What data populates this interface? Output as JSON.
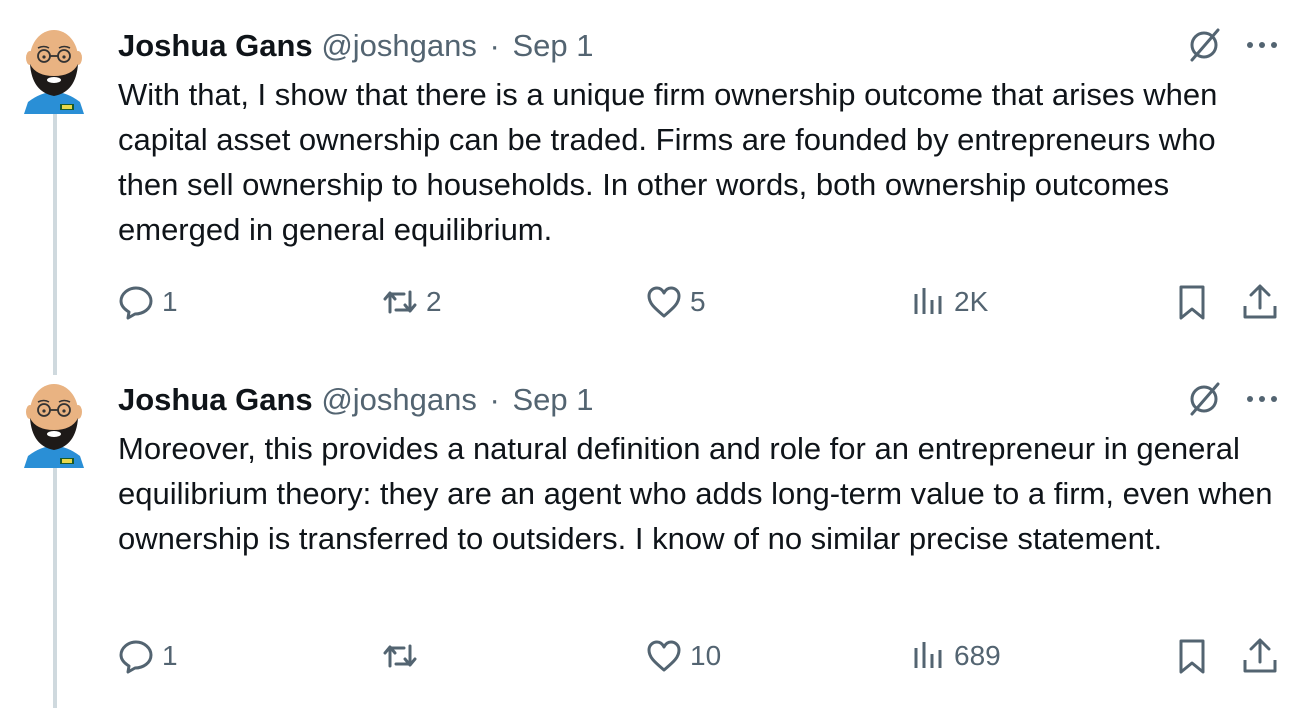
{
  "tweets": [
    {
      "author_name": "Joshua Gans",
      "handle": "@joshgans",
      "separator": "·",
      "date": "Sep 1",
      "text": "With that, I show that there is a unique firm ownership outcome that arises when capital asset ownership can be traded. Firms are founded by entrepreneurs who then sell ownership to households. In other words, both ownership outcomes emerged in general equilibrium.",
      "replies": "1",
      "reposts": "2",
      "likes": "5",
      "views": "2K"
    },
    {
      "author_name": "Joshua Gans",
      "handle": "@joshgans",
      "separator": "·",
      "date": "Sep 1",
      "text": "Moreover, this provides a natural definition and role for an entrepreneur in general equilibrium theory: they are an agent who adds long-term value to a firm, even when ownership is transferred to outsiders. I know of no similar precise statement.",
      "replies": "1",
      "reposts": "",
      "likes": "10",
      "views": "689"
    }
  ],
  "icons": {
    "reply": "reply-icon",
    "repost": "repost-icon",
    "like": "like-icon",
    "views": "views-icon",
    "bookmark": "bookmark-icon",
    "share": "share-icon",
    "grok": "grok-icon",
    "more": "more-icon"
  },
  "colors": {
    "text_primary": "#0f1419",
    "text_secondary": "#536471",
    "thread_line": "#cfd9de"
  }
}
